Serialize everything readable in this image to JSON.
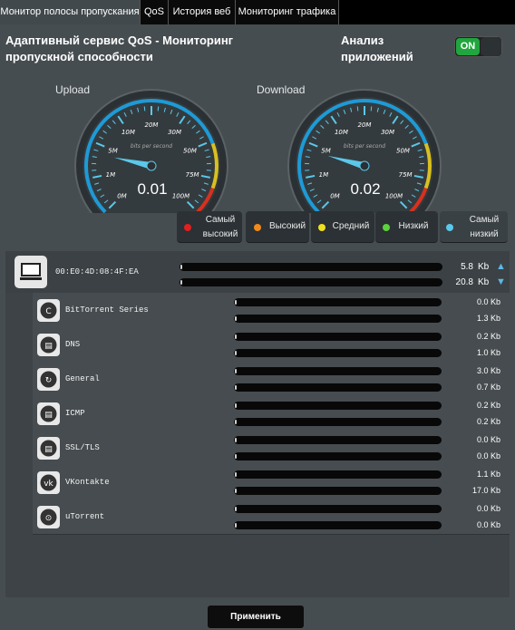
{
  "tabs": [
    {
      "label": "Монитор полосы пропускания"
    },
    {
      "label": "QoS"
    },
    {
      "label": "История веб"
    },
    {
      "label": "Мониторинг трафика"
    }
  ],
  "header": {
    "title": "Адаптивный сервис QoS - Мониторинг пропускной способности",
    "app_analysis_label": "Анализ приложений",
    "toggle_label": "ON"
  },
  "gauges": {
    "upload": {
      "label": "Upload",
      "value": "0.01"
    },
    "download": {
      "label": "Download",
      "value": "0.02"
    },
    "scale_labels": [
      "0M",
      "1M",
      "5M",
      "10M",
      "20M",
      "30M",
      "50M",
      "75M",
      "100M"
    ],
    "unit": "bits per second"
  },
  "legend": [
    {
      "label": "Самый высокий",
      "color": "#e02020"
    },
    {
      "label": "Высокий",
      "color": "#f08a1c"
    },
    {
      "label": "Средний",
      "color": "#f0e020"
    },
    {
      "label": "Низкий",
      "color": "#5ad43a"
    },
    {
      "label": "Самый низкий",
      "color": "#5bc8ea"
    }
  ],
  "device": {
    "mac": "00:E0:4D:08:4F:EA",
    "up_value": "5.8",
    "up_unit": "Kb",
    "down_value": "20.8",
    "down_unit": "Kb"
  },
  "apps": [
    {
      "name": "BitTorrent Series",
      "up": "0.0 Kb",
      "down": "1.3 Kb"
    },
    {
      "name": "DNS",
      "up": "0.2 Kb",
      "down": "1.0 Kb"
    },
    {
      "name": "General",
      "up": "3.0 Kb",
      "down": "0.7 Kb"
    },
    {
      "name": "ICMP",
      "up": "0.2 Kb",
      "down": "0.2 Kb"
    },
    {
      "name": "SSL/TLS",
      "up": "0.0 Kb",
      "down": "0.0 Kb"
    },
    {
      "name": "VKontakte",
      "up": "1.1 Kb",
      "down": "17.0 Kb"
    },
    {
      "name": "uTorrent",
      "up": "0.0 Kb",
      "down": "0.0 Kb"
    }
  ],
  "apply_label": "Применить"
}
